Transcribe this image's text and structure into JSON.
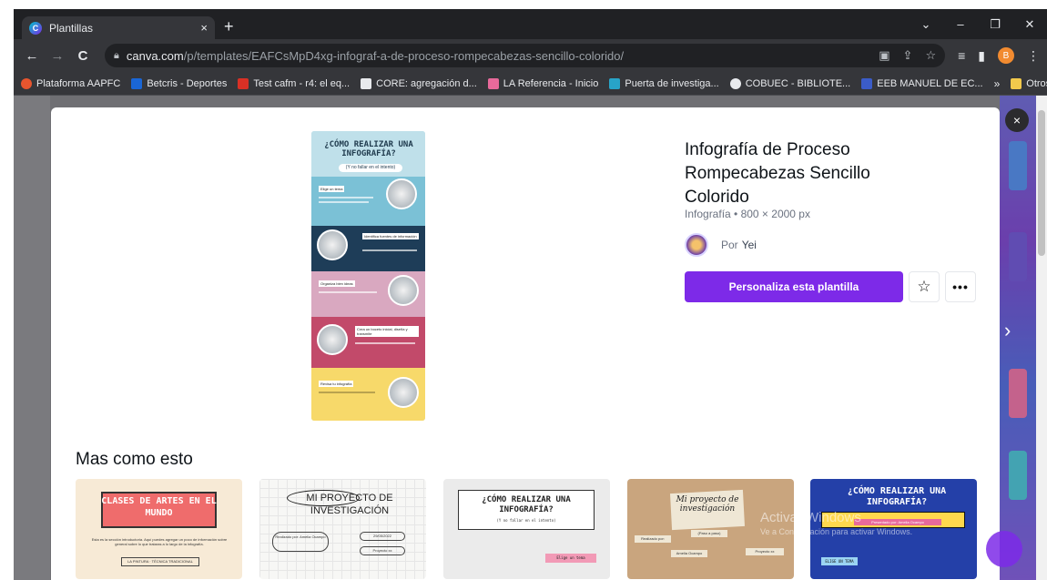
{
  "browser": {
    "tab_title": "Plantillas",
    "tab_close": "×",
    "new_tab": "+",
    "window_controls": [
      "⌄",
      "–",
      "❐",
      "✕"
    ],
    "nav": {
      "back": "←",
      "forward": "→",
      "reload": "C"
    },
    "url_host": "canva.com",
    "url_path": "/p/templates/EAFCsMpD4xg-infograf-a-de-proceso-rompecabezas-sencillo-colorido/",
    "omnibox_icons": [
      "translate-icon",
      "share-icon",
      "star-icon"
    ],
    "toolbar_icons": [
      "reading-list-icon",
      "side-panel-icon"
    ],
    "profile_initial": "B",
    "menu": "⋮"
  },
  "bookmarks": [
    {
      "label": "Plataforma AAPFC",
      "color": "#e8552e"
    },
    {
      "label": "Betcris - Deportes",
      "color": "#1a66d6"
    },
    {
      "label": "Test cafm - r4: el eq...",
      "color": "#d93025"
    },
    {
      "label": "CORE: agregación d...",
      "color": "#e8eaed"
    },
    {
      "label": "LA Referencia - Inicio",
      "color": "#e86a9b"
    },
    {
      "label": "Puerta de investiga...",
      "color": "#28a4c8"
    },
    {
      "label": "COBUEC - BIBLIOTE...",
      "color": "#e8eaed"
    },
    {
      "label": "EEB MANUEL DE EC...",
      "color": "#3b5cc8"
    }
  ],
  "bookmarks_overflow": "»",
  "other_bookmarks": "Otros marcadores",
  "preview": {
    "title": "¿CÓMO REALIZAR UNA INFOGRAFÍA?",
    "subtitle": "(Y no fallar en el intento)",
    "steps": [
      "Elige un tema",
      "Identifica fuentes de información",
      "Organiza bien ideas",
      "Crea un boceto inicial, diseña y transmite",
      "Revisa tu infografía"
    ]
  },
  "detail": {
    "title": "Infografía de Proceso Rompecabezas Sencillo Colorido",
    "meta": "Infografía • 800 × 2000 px",
    "by_label": "Por",
    "author": "Yei",
    "cta": "Personaliza esta plantilla",
    "star": "☆",
    "more": "•••",
    "close": "×",
    "next": "›"
  },
  "section_title": "Mas como esto",
  "cards": {
    "c1": {
      "title": "CLASES DE ARTES EN EL MUNDO",
      "text": "Esta es la sección introductoria. Aquí puedes agregar un poco de información sobre general sobre lo que trataras a lo largo de la infografía.",
      "tag": "LA PINTURA · TÉCNICA TRADICIONAL"
    },
    "c2": {
      "title": "MI PROYECTO DE INVESTIGACIÓN",
      "b1": "Realizado por: Amelia Ocampo",
      "b2": "29/05/2022",
      "b3": "Proyecto xx"
    },
    "c3": {
      "title": "¿CÓMO REALIZAR UNA INFOGRAFÍA?",
      "sub": "(Y no fallar en el intento)",
      "step": "Elige un tema"
    },
    "c4": {
      "title": "Mi proyecto de investigación",
      "sub": "(Paso a paso)",
      "n1": "Realizado por:",
      "n2": "Amelia Ocampo",
      "n3": "Proyecto xx"
    },
    "c5": {
      "title": "¿CÓMO REALIZAR UNA INFOGRAFÍA?",
      "bar": "Presentado por: Amelia Ocampo",
      "lbl": "ELIGE UN TEMA"
    }
  },
  "watermark": {
    "line1": "Activar Windows",
    "line2": "Ve a Configuración para activar Windows."
  }
}
